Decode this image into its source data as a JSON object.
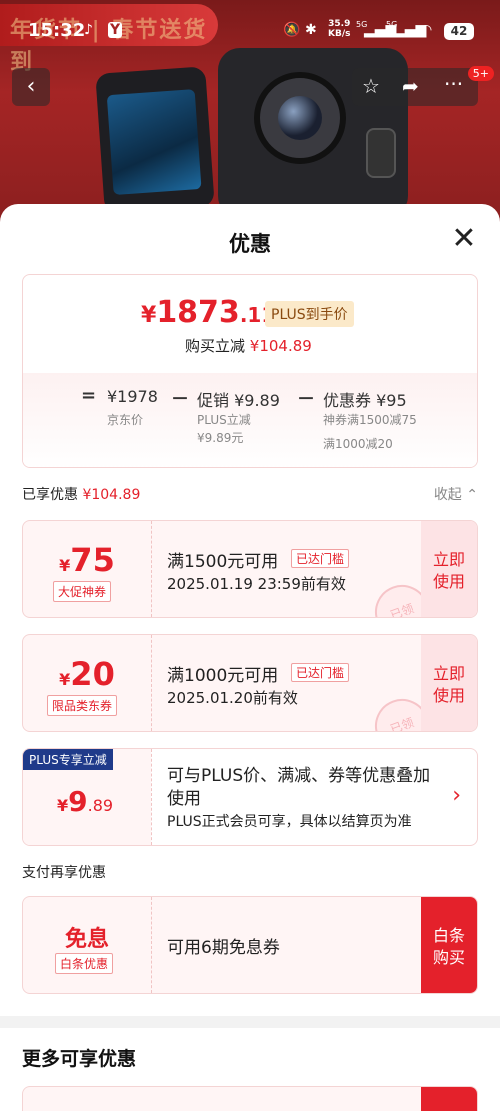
{
  "status_bar": {
    "time": "15:32",
    "net_speed_value": "35.9",
    "net_speed_unit": "KB/s",
    "battery": "42",
    "signal1": "5G",
    "signal2": "5G"
  },
  "hero": {
    "banner_text": "年货节 | 春节送货到"
  },
  "nav": {
    "back_icon": "‹",
    "star_icon": "☆",
    "share_icon": "➦",
    "more_icon": "···",
    "badge": "5+"
  },
  "sheet": {
    "title": "优惠",
    "close_icon": "✕"
  },
  "price": {
    "yen": "¥",
    "integer": "1873",
    "decimal": ".11",
    "plus_tag": "PLUS到手价",
    "instant_cut_label": "购买立减",
    "instant_cut_value": "¥104.89",
    "eq": "=",
    "jd_price": "¥1978",
    "jd_price_label": "京东价",
    "minus1": "－",
    "promo": "促销 ¥9.89",
    "promo_sub1": "PLUS立减",
    "promo_sub2": "¥9.89元",
    "minus2": "－",
    "coupon": "优惠券 ¥95",
    "coupon_sub1": "神券满1500减75",
    "coupon_sub2": "满1000减20"
  },
  "enjoyed": {
    "label": "已享优惠",
    "value": "¥104.89",
    "collapse": "收起 ⌃"
  },
  "coupons": [
    {
      "yen": "¥",
      "amount": "75",
      "type": "大促神券",
      "condition": "满1500元可用",
      "threshold": "已达门槛",
      "date": "2025.01.19 23:59前有效",
      "use_l1": "立即",
      "use_l2": "使用",
      "stamp": "已领"
    },
    {
      "yen": "¥",
      "amount": "20",
      "type": "限品类东券",
      "condition": "满1000元可用",
      "threshold": "已达门槛",
      "date": "2025.01.20前有效",
      "use_l1": "立即",
      "use_l2": "使用",
      "stamp": "已领"
    }
  ],
  "plus_card": {
    "label": "PLUS专享立减",
    "yen": "¥",
    "amount": "9",
    "decimal": ".89",
    "desc": "可与PLUS价、满减、券等优惠叠加使用",
    "note": "PLUS正式会员可享，具体以结算页为准",
    "chevron": "›"
  },
  "pay": {
    "header": "支付再享优惠",
    "title": "免息",
    "tag": "白条优惠",
    "desc": "可用6期免息券",
    "btn_l1": "白条",
    "btn_l2": "购买"
  },
  "more": {
    "title": "更多可享优惠"
  },
  "colors": {
    "accent": "#e4212b",
    "plus_blue": "#1f3a8a",
    "plus_tag_bg": "#fbe9c9"
  }
}
